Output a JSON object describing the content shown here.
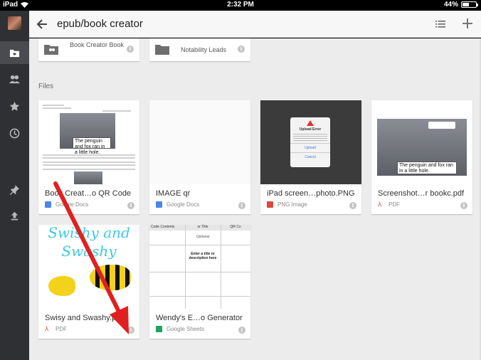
{
  "status_bar": {
    "device": "iPad",
    "time": "2:32 PM",
    "battery": "44%",
    "battery_level": 0.44
  },
  "header": {
    "title": "epub/book creator"
  },
  "folders": [
    {
      "name": "Book Creator Book"
    },
    {
      "name": "Notability Leads"
    }
  ],
  "files_label": "Files",
  "files": [
    {
      "name": "Book Creat…o QR Code",
      "type": "Google Docs",
      "type_icon": "docs-icon"
    },
    {
      "name": "IMAGE qr",
      "type": "Google Docs",
      "type_icon": "docs-icon"
    },
    {
      "name": "iPad screen…photo.PNG",
      "type": "PNG Image",
      "type_icon": "image-icon"
    },
    {
      "name": "Screenshot…r bookc.pdf",
      "type": "PDF",
      "type_icon": "pdf-icon"
    },
    {
      "name": "Swisy and Swashy.pdf",
      "type": "PDF",
      "type_icon": "pdf-icon"
    },
    {
      "name": "Wendy's E…o Generator",
      "type": "Google Sheets",
      "type_icon": "sheets-icon"
    }
  ],
  "thumbs": {
    "story_text": "The penguin and fox ran in a little hole.",
    "dialog_title": "Upload Error",
    "dialog_buttons": [
      "Upload",
      "Cancel"
    ],
    "swishy_title": "Swishy and Swashy",
    "sheet_headers": [
      "Code Contents",
      "or Title",
      "QR Co"
    ],
    "sheet_cells": [
      "Optional",
      "Enter a title or description here"
    ]
  },
  "colors": {
    "accent_red": "#e02020",
    "rail": "#2f3033",
    "header_bg": "#f7f7f7"
  }
}
